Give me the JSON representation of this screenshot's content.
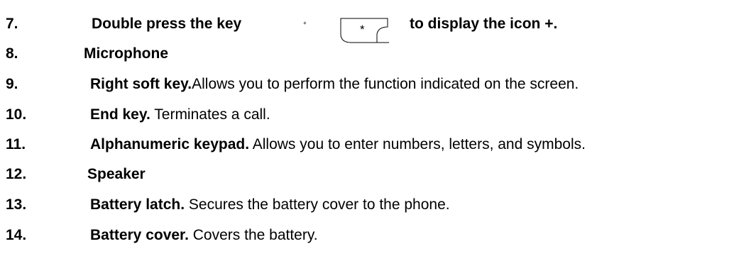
{
  "items": [
    {
      "number": "7.",
      "bold": "Double press the key",
      "text": "",
      "suffix": "to display the icon +."
    },
    {
      "number": "8.",
      "bold": "Microphone",
      "text": ""
    },
    {
      "number": "9.",
      "bold": "Right soft key.",
      "text": "Allows you to perform the function indicated on the screen."
    },
    {
      "number": "10.",
      "bold": "End key.",
      "text": " Terminates a call."
    },
    {
      "number": "11.",
      "bold": "Alphanumeric keypad.",
      "text": " Allows you to enter numbers, letters, and symbols."
    },
    {
      "number": "12.",
      "bold": "Speaker",
      "text": ""
    },
    {
      "number": "13.",
      "bold": "Battery latch.",
      "text": " Secures the battery cover to the phone."
    },
    {
      "number": "14.",
      "bold": "Battery cover.",
      "text": " Covers the battery."
    }
  ],
  "key_icon": {
    "symbol": "*",
    "superscript": "+"
  }
}
